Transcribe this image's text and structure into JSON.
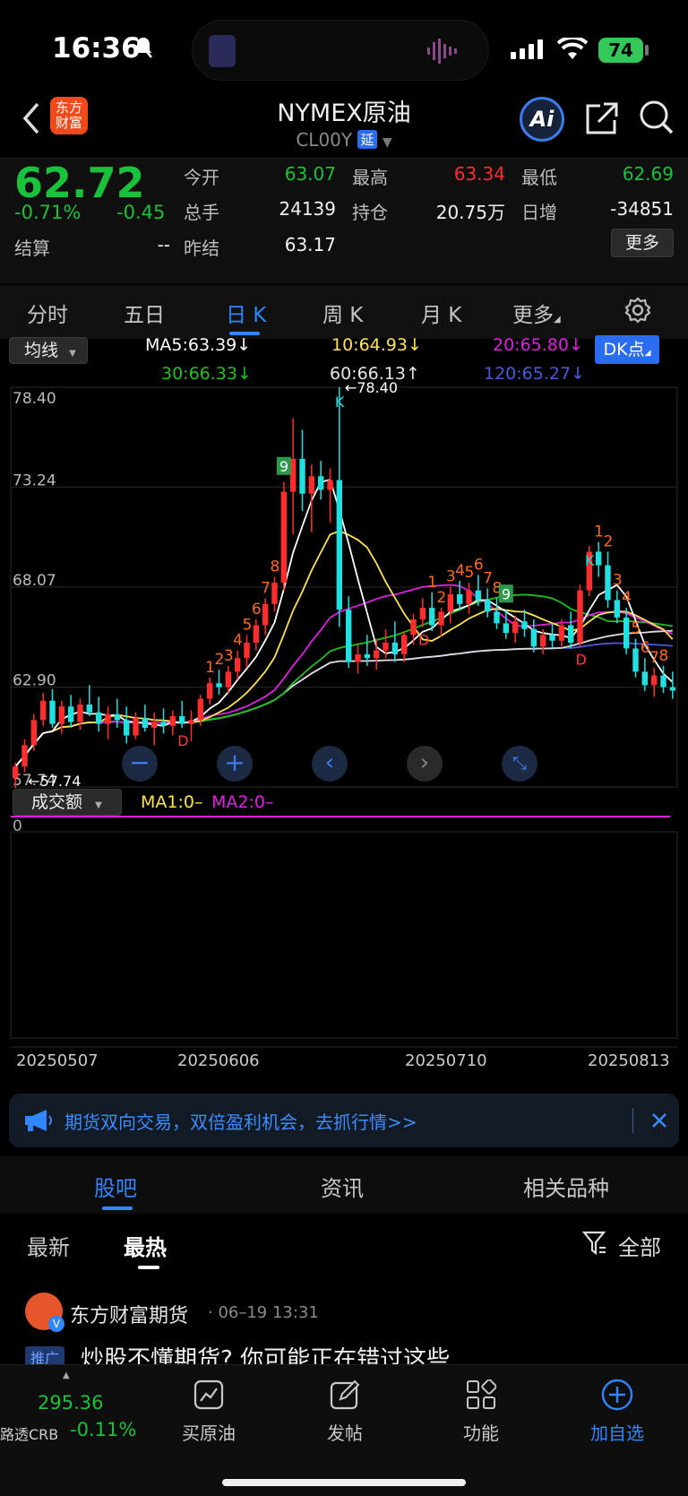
{
  "status": {
    "time": "16:36",
    "battery": "74"
  },
  "header": {
    "logo_line1": "东方",
    "logo_line2": "财富",
    "title": "NYMEX原油",
    "code": "CL00Y",
    "delay_badge": "延",
    "ai_label": "Ai"
  },
  "quote": {
    "price": "62.72",
    "change_pct": "-0.71%",
    "change": "-0.45",
    "settle_label": "结算",
    "settle_value": "--",
    "open_label": "今开",
    "open_value": "63.07",
    "volume_label": "总手",
    "volume_value": "24139",
    "prev_settle_label": "昨结",
    "prev_settle_value": "63.17",
    "high_label": "最高",
    "high_value": "63.34",
    "oi_label": "持仓",
    "oi_value": "20.75万",
    "low_label": "最低",
    "low_value": "62.69",
    "daily_inc_label": "日增",
    "daily_inc_value": "-34851",
    "more_button": "更多"
  },
  "tabs": [
    "分时",
    "五日",
    "日 K",
    "周 K",
    "月 K",
    "更多"
  ],
  "chart_controls": {
    "ma_selector": "均线",
    "dk_button": "DK点",
    "volume_selector": "成交额",
    "vol_ma1": "MA1:0–",
    "vol_ma2": "MA2:0–",
    "vol_zero": "0"
  },
  "ma_legend": {
    "ma5": "MA5:63.39",
    "ma10": "10:64.93",
    "ma20": "20:65.80",
    "ma30": "30:66.33",
    "ma60": "60:66.13",
    "ma120": "120:65.27"
  },
  "colors": {
    "up": "#ff2d2d",
    "down": "#19c23a",
    "candle_down": "#20e0e0",
    "ma5": "#ffffff",
    "ma10": "#ffe44d",
    "ma20": "#e020e0",
    "ma30": "#20c020",
    "ma60": "#dddddd",
    "ma120": "#4a5ad8"
  },
  "chart_data": {
    "type": "candlestick",
    "y_ticks": [
      "78.40",
      "73.24",
      "68.07",
      "62.90",
      "57.74"
    ],
    "ylim": [
      57.74,
      78.4
    ],
    "x_ticks": [
      "20250507",
      "20250606",
      "20250710",
      "20250813"
    ],
    "annotations": {
      "max_label": "78.40",
      "min_label": "57.74"
    },
    "candles": [
      [
        58.2,
        59.0,
        57.7,
        58.8
      ],
      [
        58.8,
        60.2,
        58.5,
        59.9
      ],
      [
        59.9,
        61.5,
        59.6,
        61.2
      ],
      [
        61.2,
        62.6,
        60.9,
        62.2
      ],
      [
        62.2,
        62.8,
        60.8,
        61.0
      ],
      [
        61.0,
        62.2,
        60.5,
        61.9
      ],
      [
        61.9,
        62.5,
        60.8,
        61.1
      ],
      [
        61.1,
        62.3,
        60.7,
        62.0
      ],
      [
        62.0,
        63.0,
        61.4,
        61.6
      ],
      [
        61.6,
        62.4,
        60.6,
        61.0
      ],
      [
        61.0,
        61.9,
        60.2,
        61.5
      ],
      [
        61.5,
        62.3,
        60.8,
        61.2
      ],
      [
        61.2,
        61.9,
        60.0,
        60.4
      ],
      [
        60.4,
        61.6,
        60.2,
        61.3
      ],
      [
        61.3,
        62.0,
        60.6,
        60.8
      ],
      [
        60.8,
        61.6,
        59.9,
        61.1
      ],
      [
        61.1,
        61.8,
        60.5,
        60.9
      ],
      [
        60.9,
        61.7,
        60.4,
        61.4
      ],
      [
        61.4,
        62.2,
        60.8,
        61.0
      ],
      [
        61.0,
        61.7,
        60.1,
        61.2
      ],
      [
        61.2,
        62.5,
        60.9,
        62.3
      ],
      [
        62.3,
        63.4,
        62.0,
        63.1
      ],
      [
        63.1,
        63.8,
        62.5,
        62.9
      ],
      [
        62.9,
        64.0,
        62.6,
        63.7
      ],
      [
        63.7,
        64.8,
        63.3,
        64.4
      ],
      [
        64.4,
        65.6,
        63.9,
        65.2
      ],
      [
        65.2,
        66.4,
        64.8,
        66.1
      ],
      [
        66.1,
        67.5,
        65.6,
        67.2
      ],
      [
        67.2,
        68.6,
        66.8,
        68.3
      ],
      [
        68.3,
        73.5,
        67.9,
        73.0
      ],
      [
        73.0,
        76.8,
        70.8,
        74.7
      ],
      [
        74.7,
        76.2,
        72.0,
        72.9
      ],
      [
        72.9,
        74.4,
        70.9,
        73.8
      ],
      [
        73.8,
        74.6,
        72.6,
        73.1
      ],
      [
        73.1,
        74.2,
        71.4,
        73.6
      ],
      [
        73.6,
        78.4,
        66.0,
        66.9
      ],
      [
        66.9,
        67.6,
        63.9,
        64.2
      ],
      [
        64.2,
        65.1,
        63.6,
        64.6
      ],
      [
        64.6,
        65.6,
        64.0,
        64.4
      ],
      [
        64.4,
        65.4,
        63.8,
        64.8
      ],
      [
        64.8,
        65.9,
        64.4,
        65.2
      ],
      [
        65.2,
        66.3,
        64.2,
        64.6
      ],
      [
        64.6,
        65.8,
        64.2,
        65.6
      ],
      [
        65.6,
        66.7,
        65.1,
        66.4
      ],
      [
        66.4,
        67.5,
        66.0,
        67.0
      ],
      [
        67.0,
        67.8,
        65.8,
        66.1
      ],
      [
        66.1,
        67.0,
        65.5,
        66.8
      ],
      [
        66.8,
        68.1,
        66.2,
        67.7
      ],
      [
        67.7,
        68.4,
        66.9,
        67.2
      ],
      [
        67.2,
        68.3,
        66.7,
        67.9
      ],
      [
        67.9,
        68.7,
        67.1,
        67.4
      ],
      [
        67.4,
        68.0,
        66.5,
        66.8
      ],
      [
        66.8,
        67.5,
        65.9,
        66.2
      ],
      [
        66.2,
        66.9,
        65.4,
        65.7
      ],
      [
        65.7,
        66.6,
        65.2,
        66.3
      ],
      [
        66.3,
        66.9,
        65.5,
        65.9
      ],
      [
        65.9,
        66.4,
        64.7,
        65.0
      ],
      [
        65.0,
        65.9,
        64.6,
        65.6
      ],
      [
        65.6,
        66.2,
        64.9,
        65.3
      ],
      [
        65.3,
        66.4,
        65.0,
        66.1
      ],
      [
        66.1,
        66.8,
        64.9,
        65.2
      ],
      [
        65.2,
        68.2,
        65.0,
        67.9
      ],
      [
        67.9,
        70.2,
        67.6,
        69.9
      ],
      [
        69.9,
        70.4,
        68.6,
        69.2
      ],
      [
        69.2,
        69.9,
        67.0,
        67.4
      ],
      [
        67.4,
        67.9,
        66.2,
        66.5
      ],
      [
        66.5,
        67.0,
        64.6,
        64.9
      ],
      [
        64.9,
        65.4,
        63.4,
        63.7
      ],
      [
        63.7,
        64.4,
        62.7,
        63.0
      ],
      [
        63.0,
        63.9,
        62.4,
        63.5
      ],
      [
        63.5,
        64.0,
        62.6,
        62.9
      ],
      [
        62.9,
        63.7,
        62.3,
        62.72
      ]
    ],
    "signals": [
      {
        "i": 21,
        "t": "1",
        "up": false
      },
      {
        "i": 22,
        "t": "2",
        "up": false
      },
      {
        "i": 23,
        "t": "3",
        "up": false
      },
      {
        "i": 24,
        "t": "4",
        "up": false
      },
      {
        "i": 25,
        "t": "5",
        "up": false
      },
      {
        "i": 26,
        "t": "6",
        "up": false
      },
      {
        "i": 27,
        "t": "7",
        "up": false
      },
      {
        "i": 28,
        "t": "8",
        "up": false
      },
      {
        "i": 29,
        "t": "9",
        "up": true
      },
      {
        "i": 35,
        "t": "K",
        "up": true
      },
      {
        "i": 45,
        "t": "1",
        "up": false
      },
      {
        "i": 46,
        "t": "2",
        "up": false
      },
      {
        "i": 47,
        "t": "3",
        "up": false
      },
      {
        "i": 48,
        "t": "4",
        "up": false
      },
      {
        "i": 49,
        "t": "5",
        "up": false
      },
      {
        "i": 50,
        "t": "6",
        "up": false
      },
      {
        "i": 51,
        "t": "7",
        "up": false
      },
      {
        "i": 52,
        "t": "8",
        "up": false
      },
      {
        "i": 53,
        "t": "9",
        "up": true
      },
      {
        "i": 62,
        "t": "K",
        "up": true
      },
      {
        "i": 63,
        "t": "1",
        "up": false
      },
      {
        "i": 64,
        "t": "2",
        "up": false
      },
      {
        "i": 65,
        "t": "3",
        "up": false
      },
      {
        "i": 66,
        "t": "4",
        "up": false
      },
      {
        "i": 67,
        "t": "5",
        "up": false
      },
      {
        "i": 68,
        "t": "6",
        "up": false
      },
      {
        "i": 69,
        "t": "7",
        "up": false
      },
      {
        "i": 70,
        "t": "8",
        "up": false
      }
    ],
    "d_marks": [
      18,
      44,
      61
    ]
  },
  "notice": {
    "text": "期货双向交易，双倍盈利机会，去抓行情>>"
  },
  "section_tabs": [
    "股吧",
    "资讯",
    "相关品种"
  ],
  "sort_tabs": {
    "latest": "最新",
    "hot": "最热",
    "filter": "全部"
  },
  "post": {
    "author": "东方财富期货",
    "time": "· 06–19 13:31",
    "tag": "推广",
    "title": "炒股不懂期货? 你可能正在错过这些"
  },
  "bottom_bar": {
    "ticker_value": "295.36",
    "ticker_name": "路透CRB",
    "ticker_change": "-0.11%",
    "buy": "买原油",
    "post": "发帖",
    "func": "功能",
    "add": "加自选"
  }
}
